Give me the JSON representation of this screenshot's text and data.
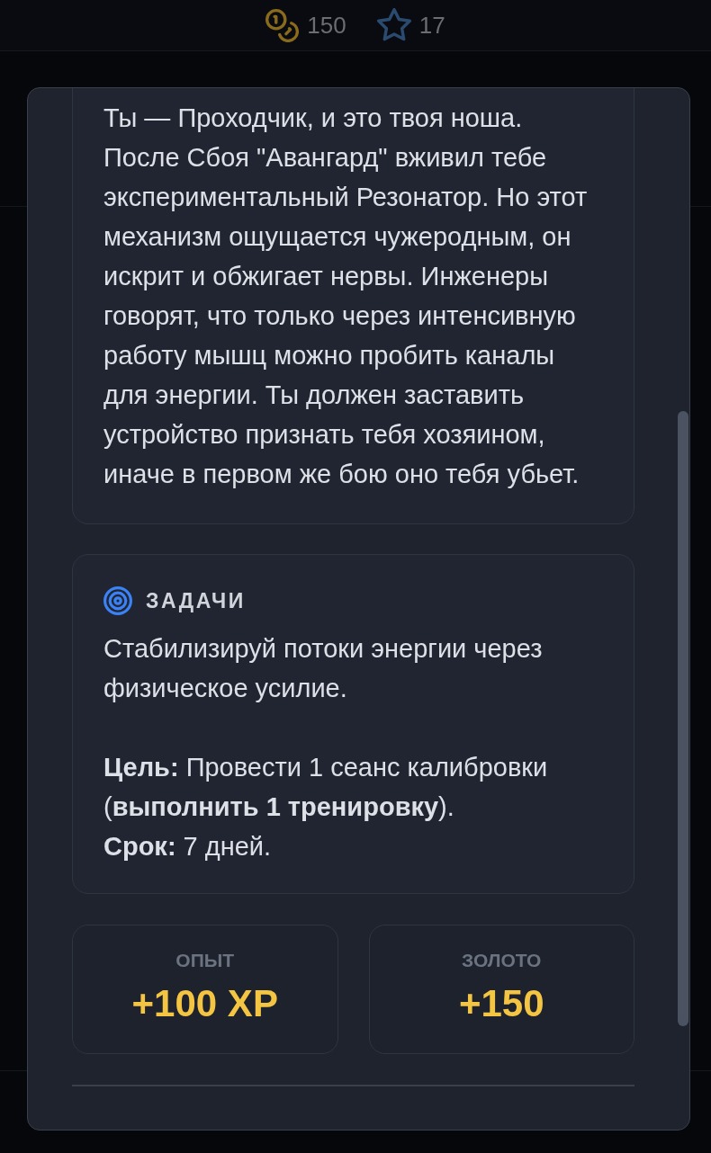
{
  "header": {
    "stats": [
      {
        "kind": "coins",
        "value": "150"
      },
      {
        "kind": "stars",
        "value": "17"
      }
    ]
  },
  "modal": {
    "story": {
      "text": "Ты — Проходчик, и это твоя ноша. После Сбоя \"Авангард\" вживил тебе экспериментальный Резонатор. Но этот механизм ощущается чужеродным, он искрит и обжигает нервы. Инженеры говорят, что только через интенсивную работу мышц можно пробить каналы для энергии. Ты должен заставить устройство признать тебя хозяином, иначе в первом же бою оно тебя убьет."
    },
    "tasks": {
      "title": "ЗАДАЧИ",
      "description": "Стабилизируй потоки энергии через физическое усилие.",
      "goal": "**Цель:** Провести 1 сеанс калибровки (**выполнить 1 тренировку**).",
      "deadline": "**Срок:** 7 дней."
    },
    "rewards": [
      {
        "label": "ОПЫТ",
        "value": "+100 XP"
      },
      {
        "label": "ЗОЛОТО",
        "value": "+150"
      }
    ]
  }
}
